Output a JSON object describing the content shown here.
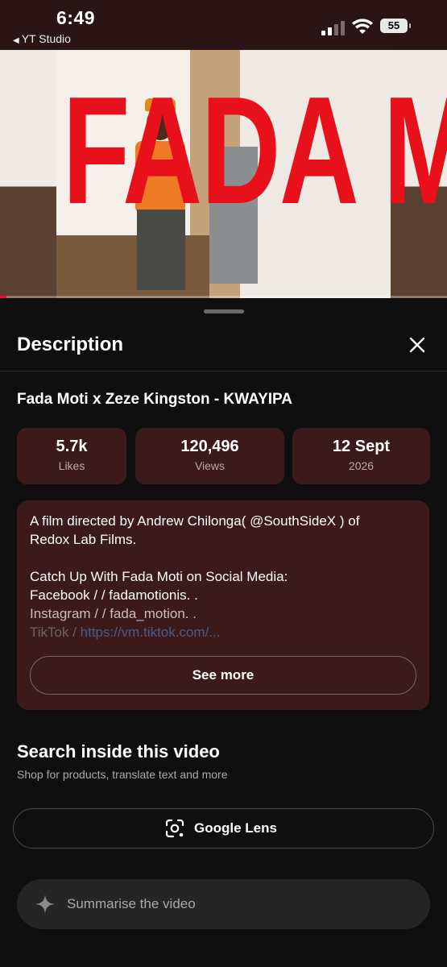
{
  "status_bar": {
    "time": "6:49",
    "back_app": "YT Studio",
    "battery": "55"
  },
  "video": {
    "overlay_title": "FADA MOTI",
    "progress_fraction": 0.015
  },
  "sheet": {
    "title": "Description",
    "video_title": "Fada Moti x Zeze Kingston - KWAYIPA",
    "stats": [
      {
        "value": "5.7k",
        "label": "Likes"
      },
      {
        "value": "120,496",
        "label": "Views"
      },
      {
        "value": "12 Sept",
        "label": "2026"
      }
    ],
    "description": {
      "line1": "A film directed by Andrew Chilonga( @SouthSideX  ) of",
      "line2": "Redox Lab Films.",
      "line3": "Catch Up With Fada Moti on Social Media:",
      "line4": "Facebook /   / fadamotionis.  .",
      "line5": "Instagram /   / fada_motion.  .",
      "line6_prefix": "TikTok / ",
      "line6_link": "https://vm.tiktok.com/..."
    },
    "see_more_label": "See more",
    "search_section": {
      "title": "Search inside this video",
      "subtitle": "Shop for products, translate text and more",
      "lens_label": "Google Lens"
    },
    "summarise_placeholder": "Summarise the video"
  },
  "colors": {
    "accent_red": "#e8111b",
    "card_bg": "#3c1a1c",
    "background": "#0f0f0f"
  },
  "icons": [
    "signal-icon",
    "wifi-icon",
    "battery-icon",
    "close-icon",
    "google-lens-icon",
    "sparkle-icon"
  ]
}
